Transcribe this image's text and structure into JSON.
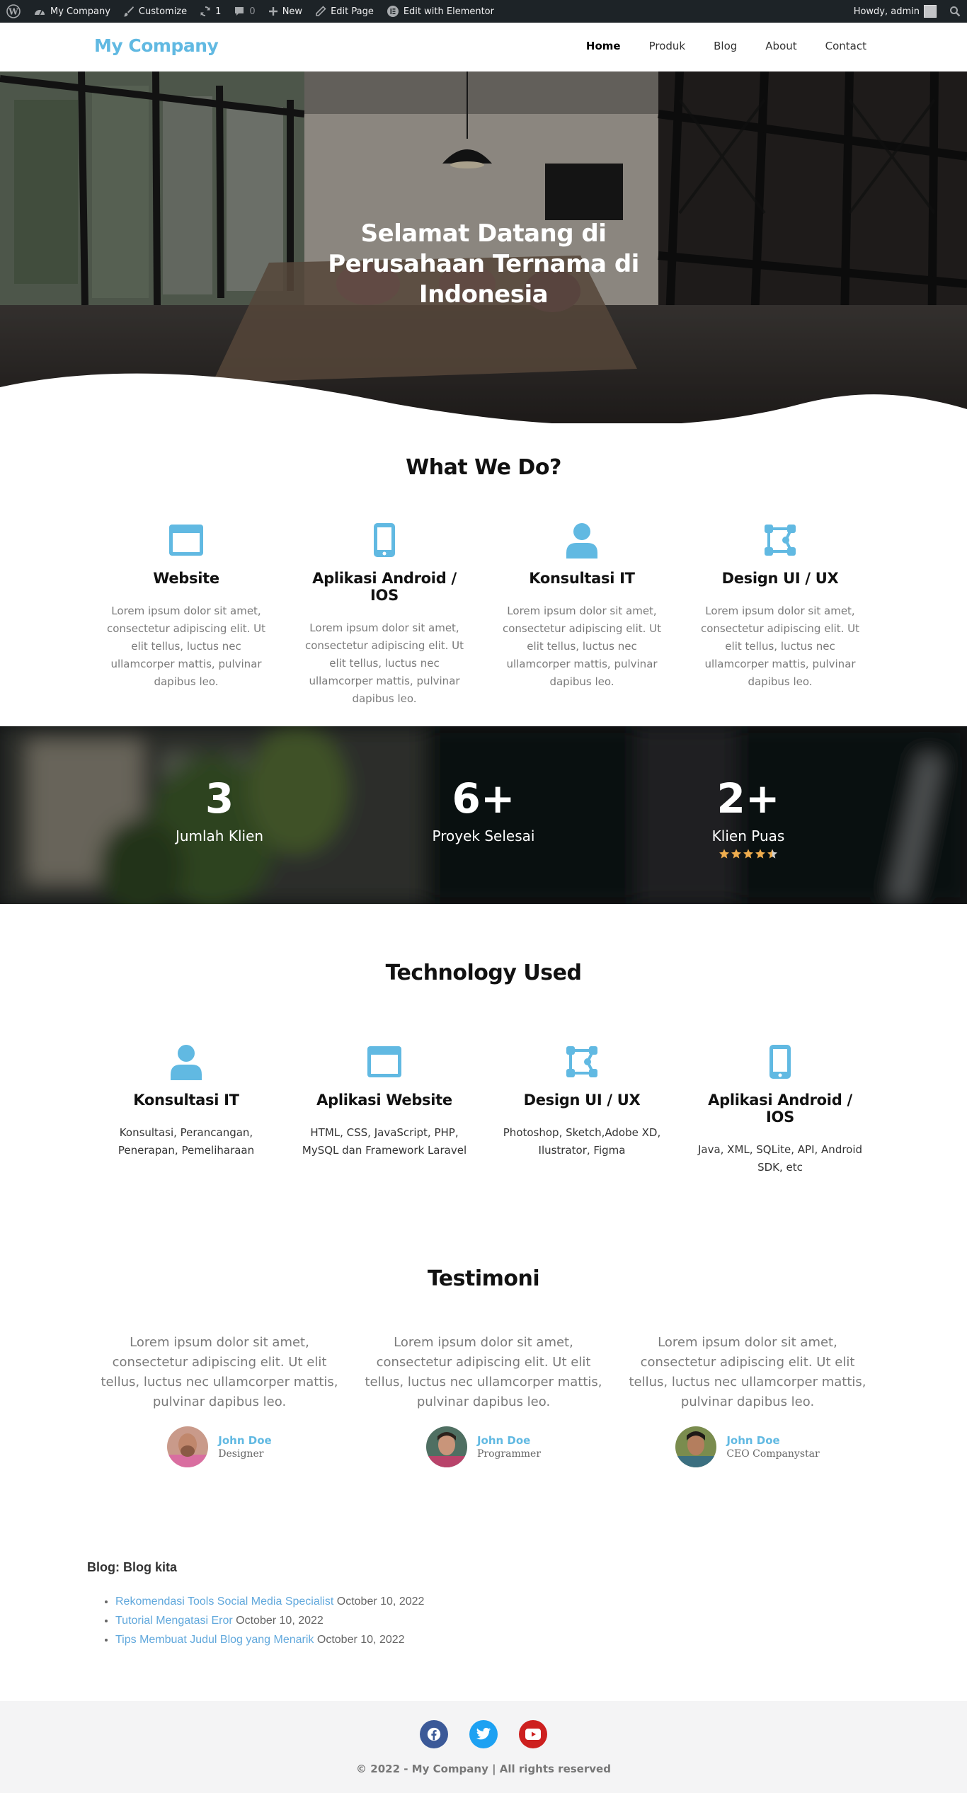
{
  "adminbar": {
    "site_name": "My Company",
    "customize": "Customize",
    "updates_count": "1",
    "comments_count": "0",
    "new_label": "New",
    "edit_page": "Edit Page",
    "edit_elementor": "Edit with Elementor",
    "howdy": "Howdy, admin"
  },
  "header": {
    "logo": "My Company",
    "nav": [
      "Home",
      "Produk",
      "Blog",
      "About",
      "Contact"
    ]
  },
  "hero": {
    "title": "Selamat Datang di Perusahaan Ternama di Indonesia"
  },
  "services": {
    "title": "What We Do?",
    "items": [
      {
        "icon": "browser-window-icon",
        "title": "Website",
        "text": "Lorem ipsum dolor sit amet, consectetur adipiscing elit. Ut elit tellus, luctus nec ullamcorper mattis, pulvinar dapibus leo."
      },
      {
        "icon": "mobile-phone-icon",
        "title": "Aplikasi Android / IOS",
        "text": "Lorem ipsum dolor sit amet, consectetur adipiscing elit. Ut elit tellus, luctus nec ullamcorper mattis, pulvinar dapibus leo."
      },
      {
        "icon": "user-icon",
        "title": "Konsultasi IT",
        "text": "Lorem ipsum dolor sit amet, consectetur adipiscing elit. Ut elit tellus, luctus nec ullamcorper mattis, pulvinar dapibus leo."
      },
      {
        "icon": "vector-design-icon",
        "title": "Design UI / UX",
        "text": "Lorem ipsum dolor sit amet, consectetur adipiscing elit. Ut elit tellus, luctus nec ullamcorper mattis, pulvinar dapibus leo."
      }
    ]
  },
  "stats": {
    "items": [
      {
        "number": "3",
        "label": "Jumlah Klien"
      },
      {
        "number": "6+",
        "label": "Proyek Selesai"
      },
      {
        "number": "2+",
        "label": "Klien Puas",
        "rating": 4.5
      }
    ]
  },
  "technology": {
    "title": "Technology Used",
    "items": [
      {
        "icon": "user-icon",
        "title": "Konsultasi IT",
        "text": "Konsultasi, Perancangan, Penerapan, Pemeliharaan"
      },
      {
        "icon": "browser-window-icon",
        "title": "Aplikasi Website",
        "text": "HTML, CSS, JavaScript, PHP, MySQL dan Framework Laravel"
      },
      {
        "icon": "vector-design-icon",
        "title": "Design UI / UX",
        "text": "Photoshop, Sketch,Adobe XD, Ilustrator, Figma"
      },
      {
        "icon": "mobile-phone-icon",
        "title": "Aplikasi Android / IOS",
        "text": "Java, XML, SQLite, API, Android SDK, etc"
      }
    ]
  },
  "testimonials": {
    "title": "Testimoni",
    "items": [
      {
        "quote": "Lorem ipsum dolor sit amet, consectetur adipiscing elit. Ut elit tellus, luctus nec ullamcorper mattis, pulvinar dapibus leo.",
        "name": "John Doe",
        "role": "Designer"
      },
      {
        "quote": "Lorem ipsum dolor sit amet, consectetur adipiscing elit. Ut elit tellus, luctus nec ullamcorper mattis, pulvinar dapibus leo.",
        "name": "John Doe",
        "role": "Programmer"
      },
      {
        "quote": "Lorem ipsum dolor sit amet, consectetur adipiscing elit. Ut elit tellus, luctus nec ullamcorper mattis, pulvinar dapibus leo.",
        "name": "John Doe",
        "role": "CEO Companystar"
      }
    ]
  },
  "blog": {
    "title": "Blog: Blog kita",
    "posts": [
      {
        "title": "Rekomendasi Tools Social Media Specialist",
        "date": "October 10, 2022"
      },
      {
        "title": "Tutorial Mengatasi Eror",
        "date": "October 10, 2022"
      },
      {
        "title": "Tips Membuat Judul Blog yang Menarik",
        "date": "October 10, 2022"
      }
    ]
  },
  "footer": {
    "socials": [
      "facebook-icon",
      "twitter-icon",
      "youtube-icon"
    ],
    "copyright": "© 2022 - My Company | All rights reserved"
  },
  "colors": {
    "accent": "#61b9e2",
    "adminbar": "#1d2327",
    "facebook": "#3b5998",
    "twitter": "#1da1f2",
    "youtube": "#cd201f",
    "star": "#f0ad4e"
  }
}
